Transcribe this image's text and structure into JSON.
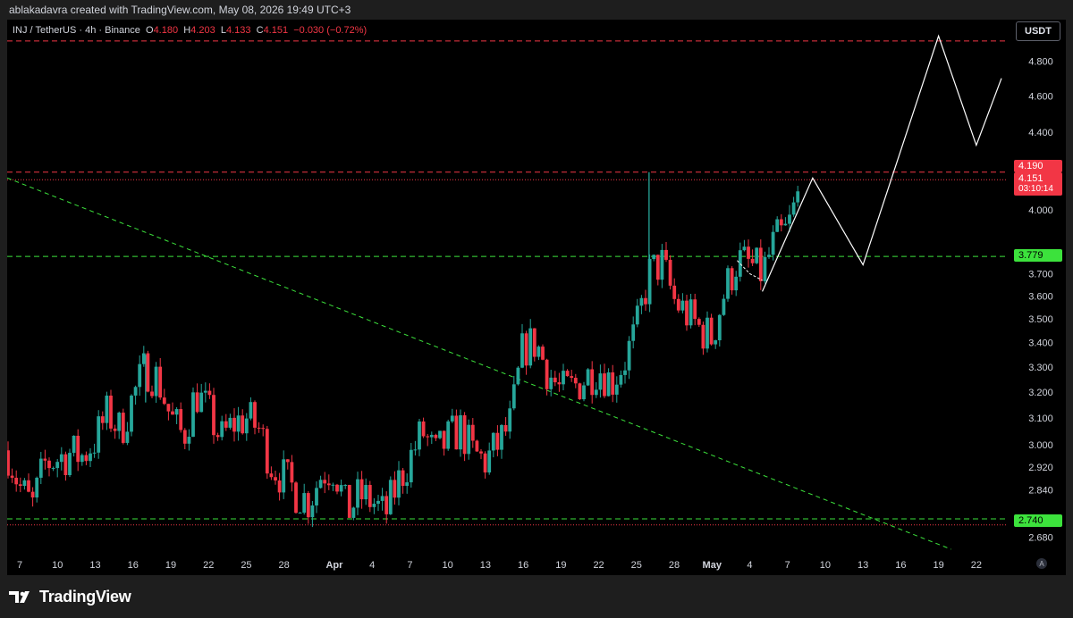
{
  "header": {
    "caption": "ablakadavra created with TradingView.com, May 08, 2026 19:49 UTC+3"
  },
  "legend": {
    "symbol": "INJ / TetherUS · 4h · Binance",
    "o_label": "O",
    "o_value": "4.180",
    "h_label": "H",
    "h_value": "4.203",
    "l_label": "L",
    "l_value": "4.133",
    "c_label": "C",
    "c_value": "4.151",
    "change": "−0.030 (−0.72%)"
  },
  "currency_button": "USDT",
  "price_labels": {
    "resistance": "4.190",
    "last": "4.151",
    "countdown": "03:10:14",
    "support_mid": "3.779",
    "support_low": "2.740"
  },
  "auto_button": "A",
  "footer": {
    "brand": "TradingView"
  },
  "colors": {
    "background": "#000000",
    "bull": "#26a69a",
    "bear": "#f23645",
    "resistance": "#f23645",
    "support": "#3ce23c",
    "projection": "#ffffff"
  },
  "chart_data": {
    "type": "candlestick",
    "title": "INJ / TetherUS · 4h · Binance",
    "y_axis": {
      "scale": "log",
      "ticks": [
        "4.800",
        "4.600",
        "4.400",
        "4.000",
        "3.700",
        "3.600",
        "3.500",
        "3.400",
        "3.300",
        "3.200",
        "3.100",
        "3.000",
        "2.920",
        "2.840",
        "2.680"
      ],
      "range": [
        2.62,
        5.05
      ]
    },
    "x_axis": {
      "ticks": [
        "7",
        "10",
        "13",
        "16",
        "19",
        "22",
        "25",
        "28",
        "Apr",
        "4",
        "7",
        "10",
        "13",
        "16",
        "19",
        "22",
        "25",
        "28",
        "May",
        "4",
        "7",
        "10",
        "13",
        "16",
        "19",
        "22"
      ],
      "bold_ticks": [
        "Apr",
        "May"
      ],
      "start": "2026-03-06",
      "end": "2026-05-24"
    },
    "ohlc_path": [
      [
        "2026-03-06",
        2.98
      ],
      [
        "2026-03-07",
        2.85
      ],
      [
        "2026-03-08",
        2.78
      ],
      [
        "2026-03-09",
        2.93
      ],
      [
        "2026-03-11",
        2.97
      ],
      [
        "2026-03-12",
        2.96
      ],
      [
        "2026-03-13",
        3.02
      ],
      [
        "2026-03-14",
        3.12
      ],
      [
        "2026-03-15",
        3.05
      ],
      [
        "2026-03-16",
        3.18
      ],
      [
        "2026-03-17",
        3.3
      ],
      [
        "2026-03-18",
        3.25
      ],
      [
        "2026-03-19",
        3.1
      ],
      [
        "2026-03-20",
        3.03
      ],
      [
        "2026-03-21",
        3.2
      ],
      [
        "2026-03-22",
        3.12
      ],
      [
        "2026-03-23",
        3.02
      ],
      [
        "2026-03-24",
        3.08
      ],
      [
        "2026-03-25",
        3.1
      ],
      [
        "2026-03-26",
        3.06
      ],
      [
        "2026-03-27",
        2.93
      ],
      [
        "2026-03-28",
        2.88
      ],
      [
        "2026-03-29",
        2.83
      ],
      [
        "2026-03-30",
        2.8
      ],
      [
        "2026-03-31",
        2.9
      ],
      [
        "2026-04-01",
        2.92
      ],
      [
        "2026-04-02",
        2.76
      ],
      [
        "2026-04-03",
        2.82
      ],
      [
        "2026-04-04",
        2.8
      ],
      [
        "2026-04-05",
        2.75
      ],
      [
        "2026-04-06",
        2.86
      ],
      [
        "2026-04-07",
        2.95
      ],
      [
        "2026-04-08",
        3.05
      ],
      [
        "2026-04-09",
        2.96
      ],
      [
        "2026-04-10",
        3.02
      ],
      [
        "2026-04-11",
        3.06
      ],
      [
        "2026-04-12",
        2.97
      ],
      [
        "2026-04-13",
        2.94
      ],
      [
        "2026-04-14",
        3.0
      ],
      [
        "2026-04-15",
        3.08
      ],
      [
        "2026-04-16",
        3.38
      ],
      [
        "2026-04-17",
        3.4
      ],
      [
        "2026-04-18",
        3.28
      ],
      [
        "2026-04-19",
        3.2
      ],
      [
        "2026-04-20",
        3.22
      ],
      [
        "2026-04-21",
        3.26
      ],
      [
        "2026-04-22",
        3.3
      ],
      [
        "2026-04-23",
        3.24
      ],
      [
        "2026-04-24",
        3.32
      ],
      [
        "2026-04-25",
        3.45
      ],
      [
        "2026-04-26",
        3.7
      ],
      [
        "2026-04-27",
        3.75
      ],
      [
        "2026-04-28",
        3.58
      ],
      [
        "2026-04-29",
        3.52
      ],
      [
        "2026-04-30",
        3.46
      ],
      [
        "2026-05-01",
        3.42
      ],
      [
        "2026-05-02",
        3.62
      ],
      [
        "2026-05-03",
        3.76
      ],
      [
        "2026-05-04",
        3.74
      ],
      [
        "2026-05-05",
        3.7
      ],
      [
        "2026-05-06",
        3.85
      ],
      [
        "2026-05-07",
        3.9
      ],
      [
        "2026-05-08",
        4.1
      ],
      [
        "2026-05-08",
        4.151
      ]
    ],
    "notable_wicks": [
      {
        "date": "2026-04-26",
        "high": 4.19,
        "low": 3.62
      },
      {
        "date": "2026-03-17",
        "high": 3.35,
        "low": 3.16
      }
    ],
    "horizontal_levels": [
      {
        "price": 4.92,
        "style": "red-dashed"
      },
      {
        "price": 4.19,
        "style": "red-dashed"
      },
      {
        "price": 4.151,
        "style": "red-dotted"
      },
      {
        "price": 3.779,
        "style": "green-dashed"
      },
      {
        "price": 2.74,
        "style": "green-dashed"
      },
      {
        "price": 2.72,
        "style": "red-dotted"
      }
    ],
    "trendline": {
      "style": "green-dashed",
      "from": [
        "2026-03-06",
        4.16
      ],
      "to": [
        "2026-05-20",
        2.64
      ]
    },
    "projection": [
      [
        "2026-05-05",
        3.62
      ],
      [
        "2026-05-09",
        4.16
      ],
      [
        "2026-05-13",
        3.74
      ],
      [
        "2026-05-19",
        4.95
      ],
      [
        "2026-05-22",
        4.33
      ],
      [
        "2026-05-24",
        4.7
      ]
    ],
    "small_projection": [
      [
        "2026-05-03",
        3.76
      ],
      [
        "2026-05-04",
        3.7
      ],
      [
        "2026-05-05",
        3.67
      ]
    ]
  }
}
